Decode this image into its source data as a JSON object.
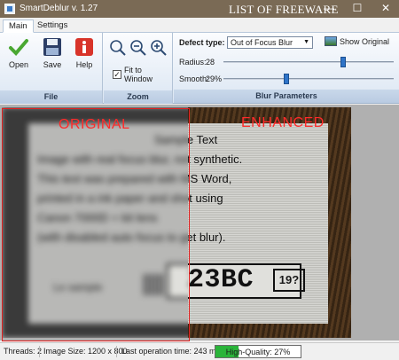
{
  "window": {
    "title": "SmartDeblur v. 1.27",
    "overlay_title": "LIST OF FREEWARE",
    "minimize": "—",
    "maximize": "☐",
    "close": "✕"
  },
  "tabs": [
    {
      "label": "Main"
    },
    {
      "label": "Settings"
    }
  ],
  "ribbon": {
    "file": {
      "label": "File",
      "open": "Open",
      "save": "Save",
      "help": "Help"
    },
    "zoom": {
      "label": "Zoom",
      "fit_to_window": "Fit to Window",
      "fit_checked": true
    },
    "blur": {
      "label": "Blur Parameters",
      "defect_type_label": "Defect type:",
      "defect_type_value": "Out of Focus Blur",
      "show_original": "Show Original",
      "radius_label": "Radius:",
      "radius_value": "28",
      "smooth_label": "Smooth:",
      "smooth_value": "29%"
    }
  },
  "image": {
    "label_original": "ORIGINAL",
    "label_enhanced": "ENHANCED",
    "doc_lines": [
      "Sample Text",
      "Image with real focus blur, not synthetic.",
      "This text was prepared with MS Word,",
      "printed in a ink paper and shot using",
      "Canon 7000D + kit lens",
      "(with disabled auto focus to get blur).",
      "",
      "23BC"
    ],
    "le_label": "Le sample",
    "plate_box": "19?"
  },
  "status": {
    "threads": "Threads: 2",
    "image_size": "Image Size: 1200 x 800",
    "last_op": "Last operation time: 243 ms",
    "quality_text": "High-Quality: 27%",
    "quality_percent": 27
  }
}
